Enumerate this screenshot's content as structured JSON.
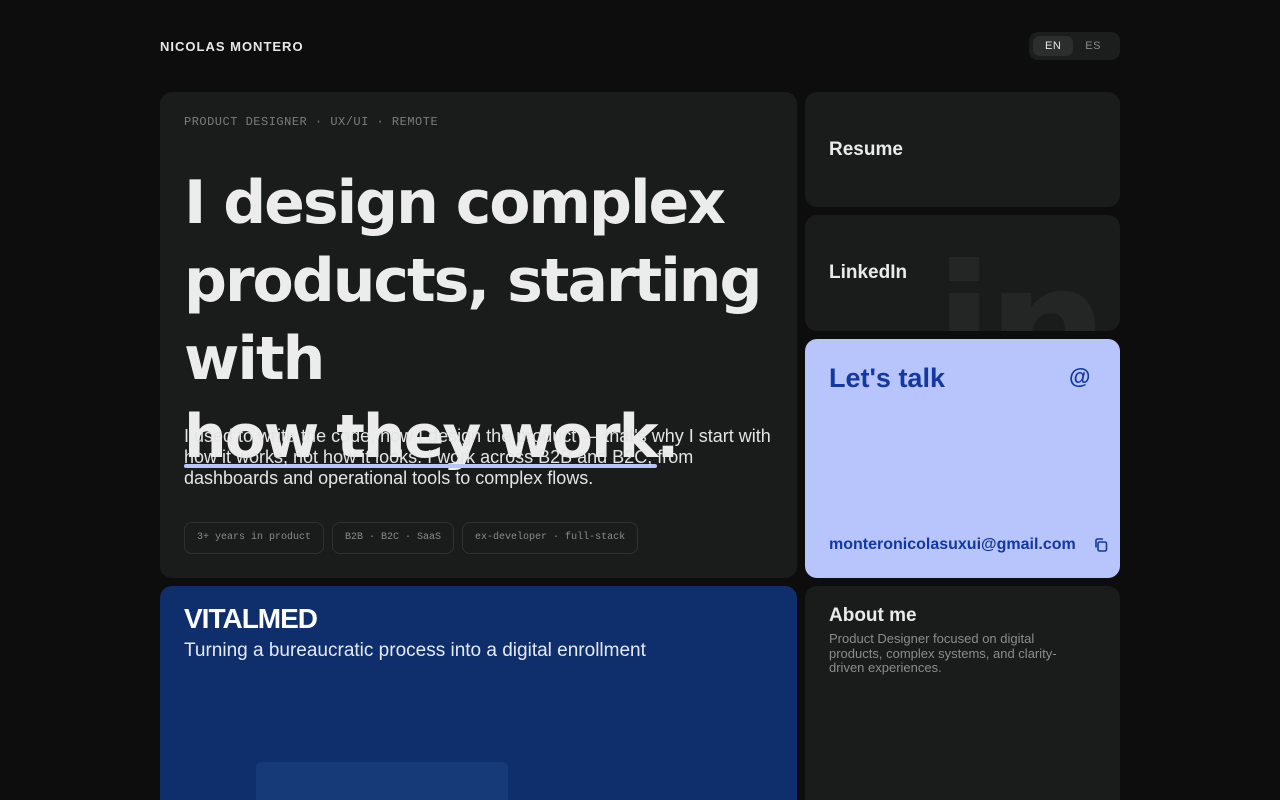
{
  "header": {
    "brand": "NICOLAS MONTERO",
    "languages": [
      {
        "label": "EN",
        "active": true
      },
      {
        "label": "ES",
        "active": false
      }
    ]
  },
  "hero": {
    "eyebrow": "PRODUCT DESIGNER · UX/UI · REMOTE",
    "headline_line1": "I design complex",
    "headline_line2": "products, starting",
    "headline_line3_prefix": "with",
    "headline_highlight": "how they work",
    "headline_period": ".",
    "intro": "I used to write the code, now I design the product — that's why I start with how it works, not how it looks. I work across B2B and B2C, from dashboards and operational tools to complex flows.",
    "chips": [
      "3+ years in product",
      "B2B · B2C · SaaS",
      "ex-developer · full-stack"
    ]
  },
  "resume": {
    "title": "Resume"
  },
  "linkedin": {
    "title": "LinkedIn",
    "watermark": "in"
  },
  "contact": {
    "title": "Let's talk",
    "at_symbol": "@",
    "email": "monteronicolasuxui@gmail.com",
    "icons": {
      "copy": "copy-icon"
    }
  },
  "about": {
    "title": "About me",
    "text": "Product Designer focused on digital products, complex systems, and clarity-driven experiences."
  },
  "project": {
    "logo": "VITALMED",
    "subtitle": "Turning a bureaucratic process into a digital enrollment"
  },
  "colors": {
    "background": "#0d0d0d",
    "card": "#1a1b1b",
    "accent_light": "#b8c5fc",
    "accent_dark": "#1338a0",
    "project_bg": "#0e2f6b"
  }
}
